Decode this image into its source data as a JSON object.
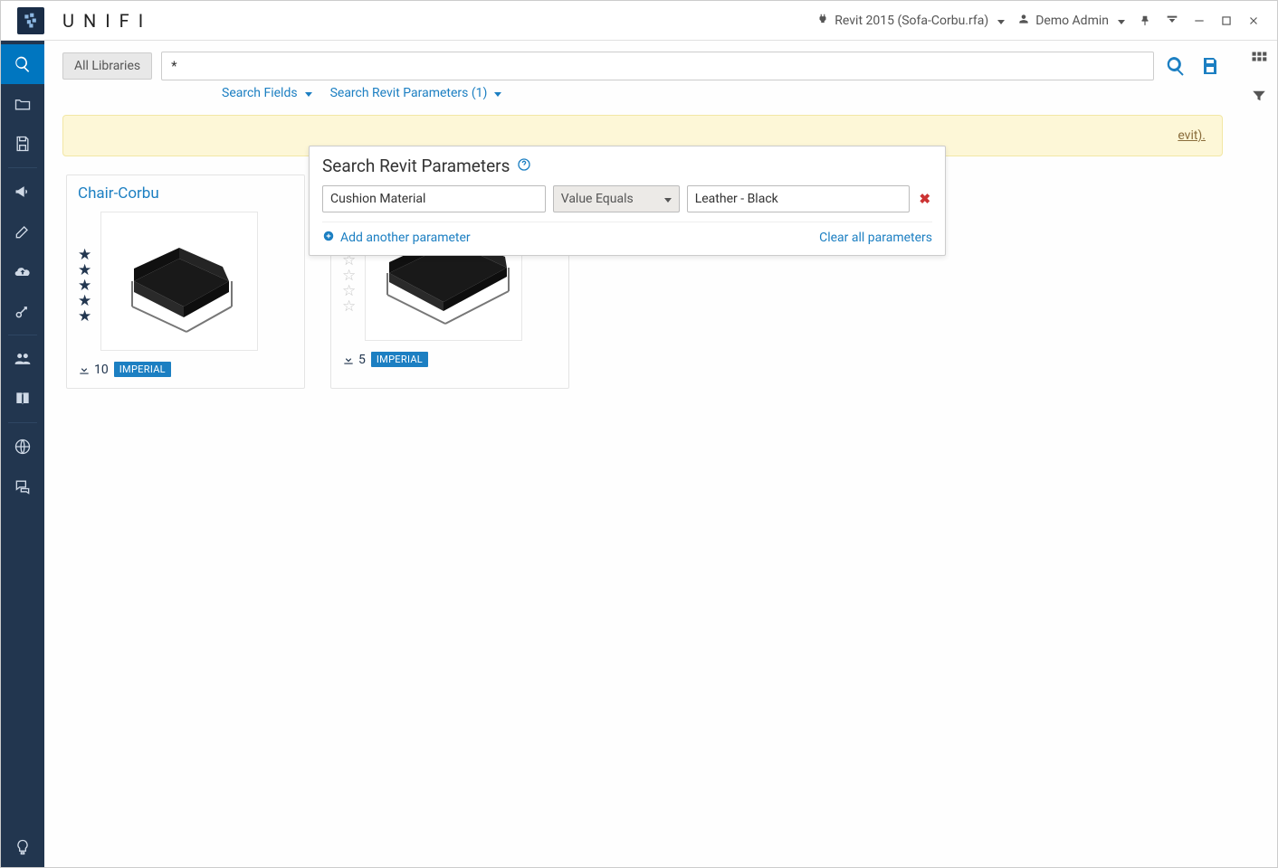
{
  "brand": "UNIFI",
  "titlebar": {
    "file_label": "Revit 2015 (Sofa-Corbu.rfa)",
    "user_label": "Demo Admin"
  },
  "search": {
    "library_label": "All Libraries",
    "query": "*",
    "filter_fields_label": "Search Fields",
    "filter_params_label": "Search Revit Parameters (1)"
  },
  "banner": {
    "suffix": "evit)."
  },
  "popover": {
    "title": "Search Revit Parameters",
    "param_name": "Cushion Material",
    "operator": "Value Equals",
    "param_value": "Leather - Black",
    "add_label": "Add another parameter",
    "clear_label": "Clear all parameters"
  },
  "cards": [
    {
      "title": "Chair-Corbu",
      "rating": 5,
      "downloads": 10,
      "badge": "IMPERIAL"
    },
    {
      "title": "",
      "rating": 0,
      "downloads": 5,
      "badge": "IMPERIAL"
    }
  ]
}
